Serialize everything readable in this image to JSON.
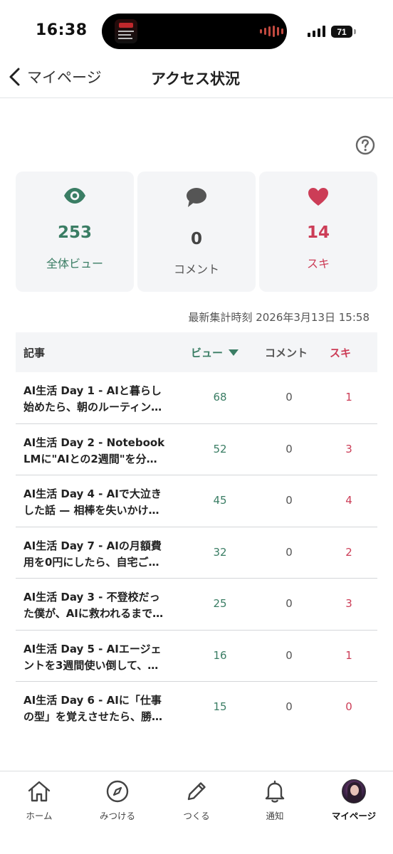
{
  "status_bar": {
    "time": "16:38",
    "battery": "71"
  },
  "header": {
    "back_label": "マイページ",
    "title": "アクセス状況"
  },
  "stats": {
    "views": {
      "value": "253",
      "label": "全体ビュー"
    },
    "comments": {
      "value": "0",
      "label": "コメント"
    },
    "likes": {
      "value": "14",
      "label": "スキ"
    }
  },
  "last_updated": "最新集計時刻 2026年3月13日 15:58",
  "table": {
    "headers": {
      "article": "記事",
      "views": "ビュー",
      "comments": "コメント",
      "likes": "スキ"
    },
    "rows": [
      {
        "line1": "AI生活 Day 1 - AIと暮らし",
        "line2": "始めたら、朝のルーティン…",
        "views": "68",
        "comments": "0",
        "likes": "1"
      },
      {
        "line1": "AI生活 Day 2 - Notebook",
        "line2": "LMに\"AIとの2週間\"を分…",
        "views": "52",
        "comments": "0",
        "likes": "3"
      },
      {
        "line1": "AI生活 Day 4 - AIで大泣き",
        "line2": "した話 — 相棒を失いかけ…",
        "views": "45",
        "comments": "0",
        "likes": "4"
      },
      {
        "line1": "AI生活 Day 7 - AIの月額費",
        "line2": "用を0円にしたら、自宅ご…",
        "views": "32",
        "comments": "0",
        "likes": "2"
      },
      {
        "line1": "AI生活 Day 3 - 不登校だっ",
        "line2": "た僕が、AIに救われるまで…",
        "views": "25",
        "comments": "0",
        "likes": "3"
      },
      {
        "line1": "AI生活 Day 5 - AIエージェ",
        "line2": "ントを3週間使い倒して、…",
        "views": "16",
        "comments": "0",
        "likes": "1"
      },
      {
        "line1": "AI生活 Day 6 - AIに「仕事",
        "line2": "の型」を覚えさせたら、勝…",
        "views": "15",
        "comments": "0",
        "likes": "0"
      }
    ]
  },
  "nav": [
    {
      "label": "ホーム",
      "icon": "home-icon"
    },
    {
      "label": "みつける",
      "icon": "compass-icon"
    },
    {
      "label": "つくる",
      "icon": "pencil-icon"
    },
    {
      "label": "通知",
      "icon": "bell-icon"
    },
    {
      "label": "マイページ",
      "icon": "avatar"
    }
  ],
  "colors": {
    "views_accent": "#3a7d64",
    "likes_accent": "#cc3d57",
    "card_bg": "#f4f5f7"
  }
}
